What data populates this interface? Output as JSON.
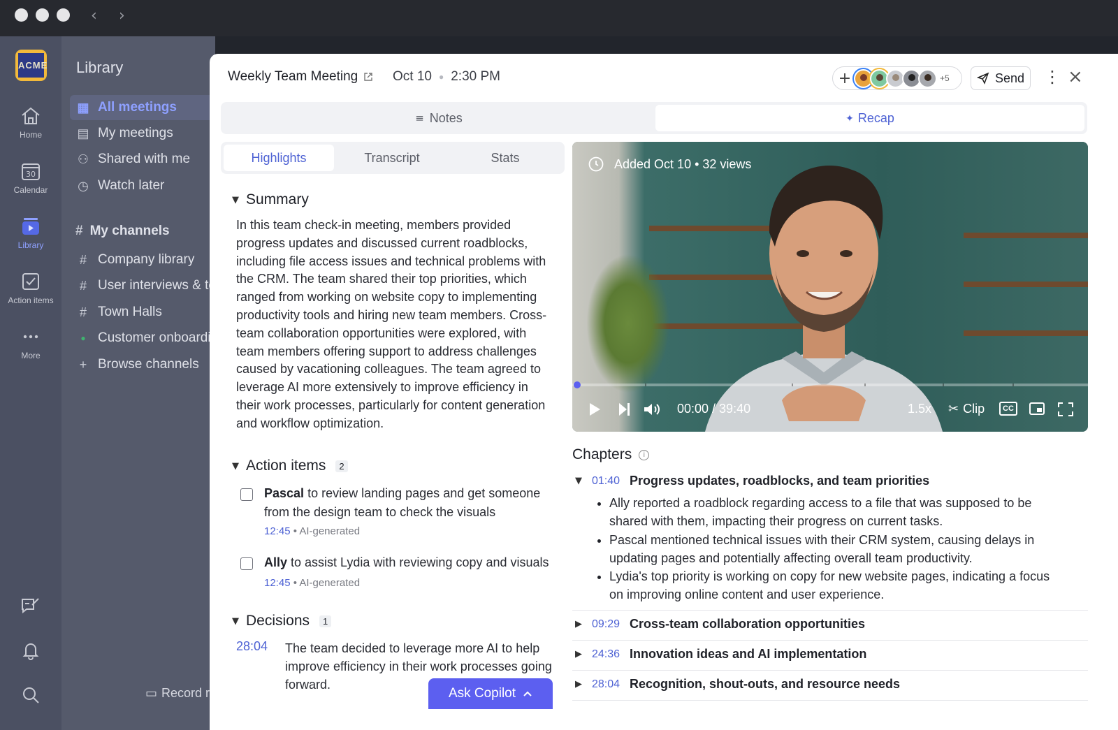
{
  "app": {
    "brand": "ACME",
    "nav_back": "‹",
    "nav_forward": "›"
  },
  "rail": [
    {
      "label": "Home"
    },
    {
      "label": "Calendar",
      "badge": "30"
    },
    {
      "label": "Library"
    },
    {
      "label": "Action items"
    },
    {
      "label": "More"
    }
  ],
  "library": {
    "title": "Library",
    "items": [
      "All meetings",
      "My meetings",
      "Shared with me",
      "Watch later"
    ],
    "channels_title": "My channels",
    "channels": [
      "Company library",
      "User interviews & te",
      "Town Halls",
      "Customer onboardin",
      "Browse channels"
    ],
    "record": "Record r"
  },
  "meeting": {
    "title": "Weekly Team Meeting",
    "date": "Oct 10",
    "time": "2:30 PM",
    "participants_more": "+5",
    "send": "Send",
    "tabs": {
      "notes": "Notes",
      "recap": "Recap"
    },
    "subtabs": [
      "Highlights",
      "Transcript",
      "Stats"
    ]
  },
  "summary": {
    "title": "Summary",
    "text": "In this team check-in meeting, members provided progress updates and discussed current roadblocks, including file access issues and technical problems with the CRM. The team shared their top priorities, which ranged from working on website copy to implementing productivity tools and hiring new team members. Cross-team collaboration opportunities were explored, with team members offering support to address challenges caused by vacationing colleagues. The team agreed to leverage AI more extensively to improve efficiency in their work processes, particularly for content generation and workflow optimization."
  },
  "action_items": {
    "title": "Action items",
    "count": "2",
    "items": [
      {
        "who": "Pascal",
        "text": " to review landing pages and get someone from the design team to check the visuals",
        "ts": "12:45",
        "tag": "AI-generated"
      },
      {
        "who": "Ally",
        "text": " to assist Lydia with reviewing copy and visuals",
        "ts": "12:45",
        "tag": "AI-generated"
      }
    ]
  },
  "decisions": {
    "title": "Decisions",
    "count": "1",
    "ts": "28:04",
    "text": "The team decided to leverage more AI to help improve efficiency in their work processes going forward."
  },
  "copilot": "Ask Copilot",
  "video": {
    "meta": "Added Oct 10 • 32 views",
    "time": "00:00 / 39:40",
    "speed": "1.5x",
    "clip": "Clip",
    "cc": "CC",
    "progress": 0
  },
  "chapters": {
    "title": "Chapters",
    "items": [
      {
        "ts": "01:40",
        "title": "Progress updates, roadblocks, and team priorities"
      },
      {
        "ts": "09:29",
        "title": "Cross-team collaboration opportunities"
      },
      {
        "ts": "24:36",
        "title": "Innovation ideas and AI implementation"
      },
      {
        "ts": "28:04",
        "title": "Recognition, shout-outs, and resource needs"
      }
    ],
    "bullets": [
      "Ally reported a roadblock regarding access to a file that was supposed to be shared with them, impacting their progress on current tasks.",
      "Pascal mentioned technical issues with their CRM system, causing delays in updating pages and potentially affecting overall team productivity.",
      "Lydia's top priority is working on copy for new website pages, indicating a focus on improving online content and user experience."
    ]
  },
  "colors": {
    "accent": "#4e62d4",
    "copilot": "#5c5ff0",
    "rail": "#4b5062"
  }
}
